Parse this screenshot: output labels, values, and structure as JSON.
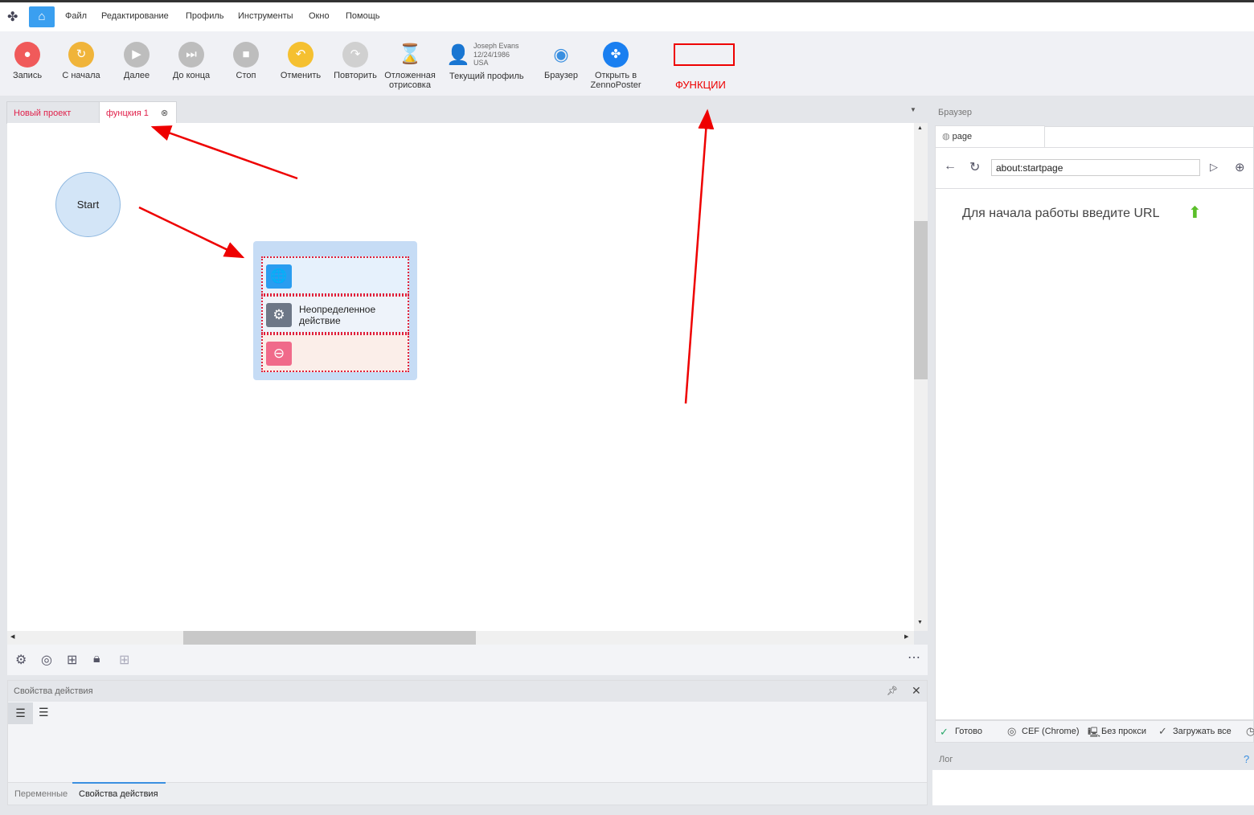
{
  "menu": {
    "items": [
      "Файл",
      "Редактирование",
      "Профиль",
      "Инструменты",
      "Окно",
      "Помощь"
    ]
  },
  "toolbar": {
    "buttons": [
      {
        "label": "Запись",
        "color": "#f05a5a",
        "glyph": "●"
      },
      {
        "label": "С начала",
        "color": "#f0b43a",
        "glyph": "↻"
      },
      {
        "label": "Далее",
        "color": "#bdbdbd",
        "glyph": "▶"
      },
      {
        "label": "До конца",
        "color": "#bdbdbd",
        "glyph": "⏭"
      },
      {
        "label": "Стоп",
        "color": "#bdbdbd",
        "glyph": "■"
      },
      {
        "label": "Отменить",
        "color": "#f5c030",
        "glyph": "↶"
      },
      {
        "label": "Повторить",
        "color": "#d0d0d0",
        "glyph": "↷"
      }
    ],
    "deferred": "Отложенная отрисовка",
    "profile": {
      "name": "Joseph Evans",
      "dob": "12/24/1986",
      "country": "USA",
      "label": "Текущий профиль"
    },
    "browser": "Браузер",
    "open_zp": "Открыть в ZennoPoster",
    "annotation": "ФУНКЦИИ"
  },
  "tabs": [
    {
      "label": "Новый проект"
    },
    {
      "label": "фунцкия 1"
    }
  ],
  "canvas": {
    "start": "Start",
    "action": "Неопределенное действие"
  },
  "props": {
    "title": "Свойства действия",
    "tabs": [
      "Переменные",
      "Свойства действия"
    ]
  },
  "browser": {
    "title": "Браузер",
    "tab": "page",
    "url": "about:startpage",
    "hint": "Для начала работы введите URL",
    "status": [
      "Готово",
      "CEF (Chrome)",
      "Без прокси",
      "Загружать все"
    ],
    "log": "Лог",
    "help": "?"
  }
}
